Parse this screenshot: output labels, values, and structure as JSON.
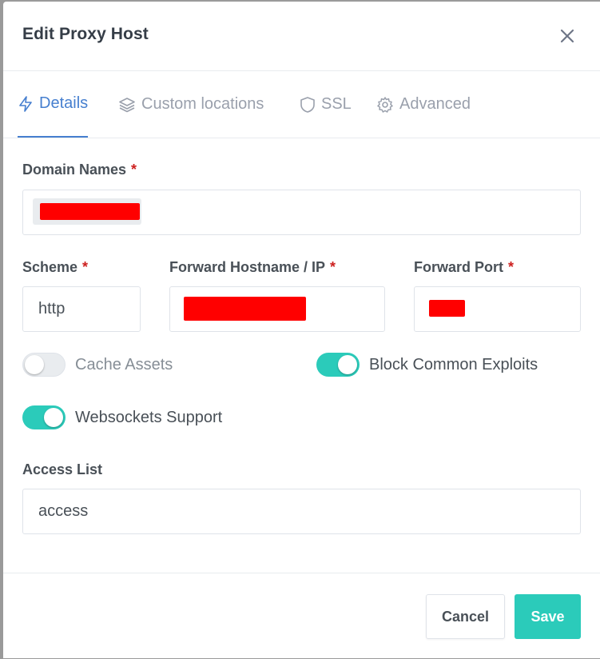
{
  "modal": {
    "title": "Edit Proxy Host"
  },
  "tabs": [
    {
      "label": "Details",
      "icon": "lightning-icon",
      "active": true
    },
    {
      "label": "Custom locations",
      "icon": "layers-icon",
      "active": false
    },
    {
      "label": "SSL",
      "icon": "shield-icon",
      "active": false
    },
    {
      "label": "Advanced",
      "icon": "gear-icon",
      "active": false
    }
  ],
  "form": {
    "domain_names": {
      "label": "Domain Names",
      "required": "*"
    },
    "scheme": {
      "label": "Scheme",
      "required": "*",
      "value": "http"
    },
    "forward_host": {
      "label": "Forward Hostname / IP",
      "required": "*"
    },
    "forward_port": {
      "label": "Forward Port",
      "required": "*"
    },
    "cache_assets": {
      "label": "Cache Assets",
      "enabled": false
    },
    "block_exploits": {
      "label": "Block Common Exploits",
      "enabled": true
    },
    "websockets": {
      "label": "Websockets Support",
      "enabled": true
    },
    "access_list": {
      "label": "Access List",
      "value": "access"
    }
  },
  "footer": {
    "cancel_label": "Cancel",
    "save_label": "Save"
  },
  "colors": {
    "accent": "#467fcf",
    "toggle_on": "#2bcbba",
    "required": "#cd201f",
    "redaction": "#ff0000"
  }
}
